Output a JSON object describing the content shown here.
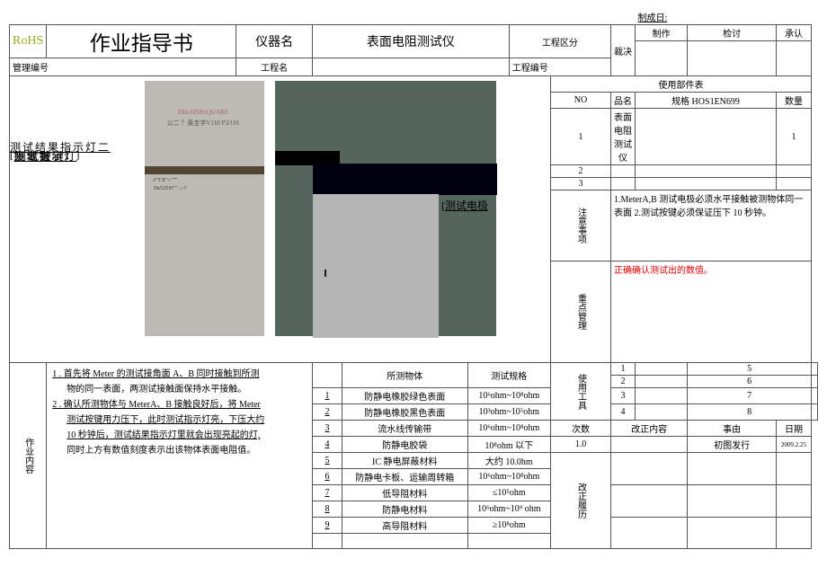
{
  "date_made_lbl": "制成日:",
  "header": {
    "rohs": "RoHS",
    "title": "作业指导书",
    "instr_name_lbl": "仪器名",
    "instr_name": "表面电阻测试仪",
    "process_div_lbl": "工程区分",
    "judge_lbl": "裁决",
    "made_lbl": "制作",
    "review_lbl": "检讨",
    "approve_lbl": "承认",
    "mgmt_no_lbl": "管理编号",
    "process_name_lbl": "工程名",
    "process_no_lbl": "工程编号"
  },
  "photo": {
    "brand": "DHeSPIRSQUARE",
    "model": "公二 ？黄圭字V110  P'á'101",
    "ce": "r'\"CE\":-'\"\"'",
    "sn": "He51EN'\"\"..:-?",
    "lbls": {
      "l1": "测试结果指示灯二",
      "l2l": "|",
      "l2": "测试指示灯",
      "l2r": "j",
      "l3l": "[",
      "l3": "测试按键",
      "l3r": "j",
      "l4l": "|",
      "l4": "接地键",
      "l4r": ";",
      "probe_l": "[",
      "probe": "测试电极"
    }
  },
  "parts": {
    "title": "使用部件表",
    "h1": "NO",
    "h2": "品名",
    "h3": "规格 HOS1EN699",
    "h4": "数量",
    "r1_name": "表面电阻测试仪",
    "r1_qty": "1"
  },
  "note": {
    "title": "注意事项",
    "text": "1.MeterA,B 测试电极必须水平接触被测物体同一表面 2.测试按键必须保证压下 10 秒钟。"
  },
  "keypt": {
    "title": "重点管理",
    "text": "正确确认测试出的数值。"
  },
  "tools": {
    "title": "使用工具",
    "1": "1",
    "2": "2",
    "3": "3",
    "4": "4",
    "5": "5",
    "6": "6",
    "7": "7",
    "8": "8"
  },
  "work": {
    "title": "作业内容",
    "t1": "1 . 首先将 Meter 的测试接角面 A、B 同时接触到所测",
    "t1b": "物的同一表面，两测试接触面保持水平接触。",
    "t2": "2 . 确认所测物体与 MeterA、B 接触良好后，将 Meter",
    "t2b": "测试按键用力压下，此时测试指示灯亮，下压大约",
    "t2c": "10 秒钟后，测试结果指示灯里就会出现亮起的灯,",
    "t2d": "同时上方有数值刻度表示出该物体表面电阻值。"
  },
  "mat": {
    "h1": "所测物体",
    "h2": "测试规格",
    "rows": [
      {
        "n": "1",
        "a": "防静电橡胶绿色表面",
        "b": "10⁶ohm~10⁸ohm"
      },
      {
        "n": "2",
        "a": "防静电橡胶黑色表面",
        "b": "10³ohm~10⁵ohm"
      },
      {
        "n": "3",
        "a": "流水线传输带",
        "b": "10⁶ohm~10⁸ohm"
      },
      {
        "n": "4",
        "a": "防静电胶袋",
        "b": "10⁸ohm 以下"
      },
      {
        "n": "5",
        "a": "IC 静电屏蔽材料",
        "b": "大约 10.0hm"
      },
      {
        "n": "6",
        "a": "防静电卡板、运输周转箱",
        "b": "10⁶ohm~10⁸ohm"
      },
      {
        "n": "7",
        "a": "低导阻材料",
        "b": "≤10⁵ohm"
      },
      {
        "n": "8",
        "a": "防静电材料",
        "b": "10⁶ohm~10⁹ ohm"
      },
      {
        "n": "9",
        "a": "高导阻材料",
        "b": "≥10⁸ohm"
      }
    ]
  },
  "rev": {
    "h1": "次数",
    "h2": "改正内容",
    "h3": "事由",
    "h4": "日期",
    "title": "改正履历",
    "r1": {
      "a": "1.0",
      "c": "初图发行",
      "d": "2009.2.25"
    }
  }
}
